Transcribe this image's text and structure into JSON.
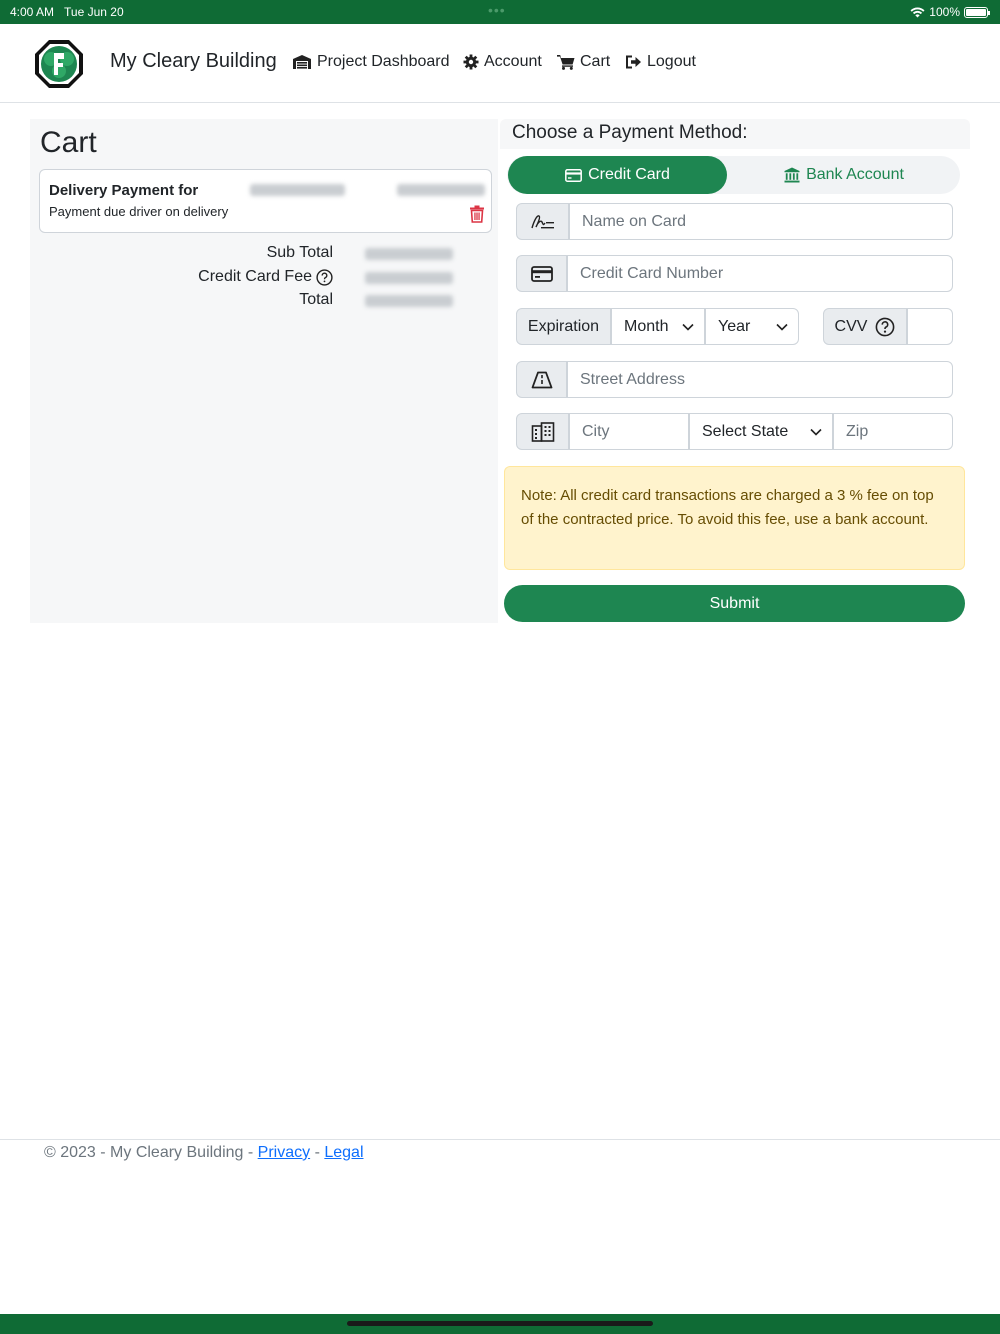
{
  "status_bar": {
    "time": "4:00 AM",
    "date": "Tue Jun 20",
    "battery": "100%"
  },
  "navbar": {
    "brand": "My Cleary Building",
    "items": [
      {
        "label": "Project Dashboard",
        "icon": "garage-icon"
      },
      {
        "label": "Account",
        "icon": "gear-icon"
      },
      {
        "label": "Cart",
        "icon": "cart-icon"
      },
      {
        "label": "Logout",
        "icon": "logout-icon"
      }
    ]
  },
  "cart": {
    "title": "Cart",
    "item": {
      "title": "Delivery Payment for",
      "description": "Payment due driver on delivery"
    },
    "sub_total_label": "Sub Total",
    "fee_label": "Credit Card Fee",
    "total_label": "Total"
  },
  "payment": {
    "title": "Choose a Payment Method:",
    "tab_credit": "Credit Card",
    "tab_bank": "Bank Account",
    "name_placeholder": "Name on Card",
    "number_placeholder": "Credit Card Number",
    "expiration_label": "Expiration",
    "month": "Month",
    "year": "Year",
    "cvv_label": "CVV",
    "street_placeholder": "Street Address",
    "city_placeholder": "City",
    "state": "Select State",
    "zip_placeholder": "Zip",
    "note": "Note: All credit card transactions are charged a 3 % fee on top of the contracted price. To avoid this fee, use a bank account.",
    "submit": "Submit"
  },
  "footer": {
    "copyright": "© 2023 - My Cleary Building -",
    "privacy": "Privacy",
    "separator": "-",
    "legal": "Legal"
  },
  "colors": {
    "brand_green": "#1e8651",
    "status_green": "#0f6b35",
    "danger": "#dc3545"
  }
}
